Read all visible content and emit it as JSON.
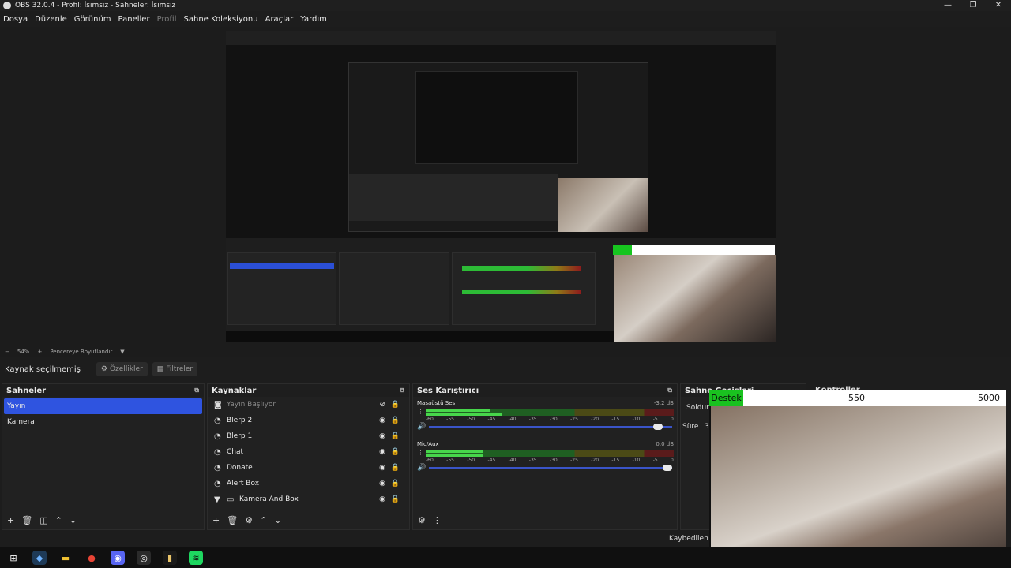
{
  "window": {
    "title": "OBS 32.0.4 - Profil: İsimsiz - Sahneler: İsimsiz",
    "controls": [
      "—",
      "❐",
      "✕"
    ]
  },
  "menu": [
    "Dosya",
    "Düzenle",
    "Görünüm",
    "Paneller",
    "Profil",
    "Sahne Koleksiyonu",
    "Araçlar",
    "Yardım"
  ],
  "status": {
    "zoom": "54%",
    "minus": "−",
    "plus": "+",
    "fit": "Pencereye Boyutlandır",
    "arrow": "▼"
  },
  "toolbar": {
    "no_source": "Kaynak seçilmemiş",
    "properties": "Özellikler",
    "filters": "Filtreler"
  },
  "scenes": {
    "title": "Sahneler",
    "items": [
      "Yayın",
      "Kamera"
    ],
    "selected": 0
  },
  "sources": {
    "title": "Kaynaklar",
    "items": [
      {
        "name": "Yayın Başlıyor",
        "icon": "◙",
        "hidden": true
      },
      {
        "name": "Blerp 2",
        "icon": "◔"
      },
      {
        "name": "Blerp 1",
        "icon": "◔"
      },
      {
        "name": "Chat",
        "icon": "◔"
      },
      {
        "name": "Donate",
        "icon": "◔"
      },
      {
        "name": "Alert Box",
        "icon": "◔"
      },
      {
        "name": "Kamera And Box",
        "icon": "▭",
        "group": true
      }
    ]
  },
  "mixer": {
    "title": "Ses Karıştırıcı",
    "channels": [
      {
        "name": "Masaüstü Ses",
        "db": "-3.2 dB",
        "level": 0.26,
        "peak": 0.31,
        "volume": 0.96
      },
      {
        "name": "Mic/Aux",
        "db": "0.0 dB",
        "level": 0.23,
        "peak": 0.23,
        "volume": 1.0
      }
    ],
    "ticks": [
      "-60",
      "-55",
      "-50",
      "-45",
      "-40",
      "-35",
      "-30",
      "-25",
      "-20",
      "-15",
      "-10",
      "-5",
      "0"
    ]
  },
  "transitions": {
    "title": "Sahne Geçişleri",
    "fade": "Soldur",
    "duration": "Süre",
    "duration_value": "30"
  },
  "controls": {
    "title": "Kontroller",
    "dropped": "Kaybedilen Ka"
  },
  "overlay": {
    "label": "Destek",
    "current": "550",
    "goal": "5000",
    "progress": 0.11
  },
  "taskbar": [
    {
      "name": "windows-icon",
      "glyph": "⊞",
      "color": "#ffffff",
      "bg": "#101010"
    },
    {
      "name": "app-icon",
      "glyph": "◆",
      "color": "#6fb3ff",
      "bg": "#1e3a57"
    },
    {
      "name": "folder-icon",
      "glyph": "▬",
      "color": "#f1c232",
      "bg": "#101010"
    },
    {
      "name": "chrome-icon",
      "glyph": "●",
      "color": "#e84435",
      "bg": "#101010"
    },
    {
      "name": "discord-icon",
      "glyph": "◉",
      "color": "#ffffff",
      "bg": "#5865f2"
    },
    {
      "name": "obs-icon",
      "glyph": "◎",
      "color": "#ffffff",
      "bg": "#2b2b2b"
    },
    {
      "name": "app2-icon",
      "glyph": "▮",
      "color": "#e9c46a",
      "bg": "#1a1a1a"
    },
    {
      "name": "spotify-icon",
      "glyph": "≋",
      "color": "#101010",
      "bg": "#1ed760"
    }
  ],
  "colors": {
    "accent": "#2f54e0",
    "meter_green": "#47d64b",
    "overlay_green": "#19c21f"
  }
}
